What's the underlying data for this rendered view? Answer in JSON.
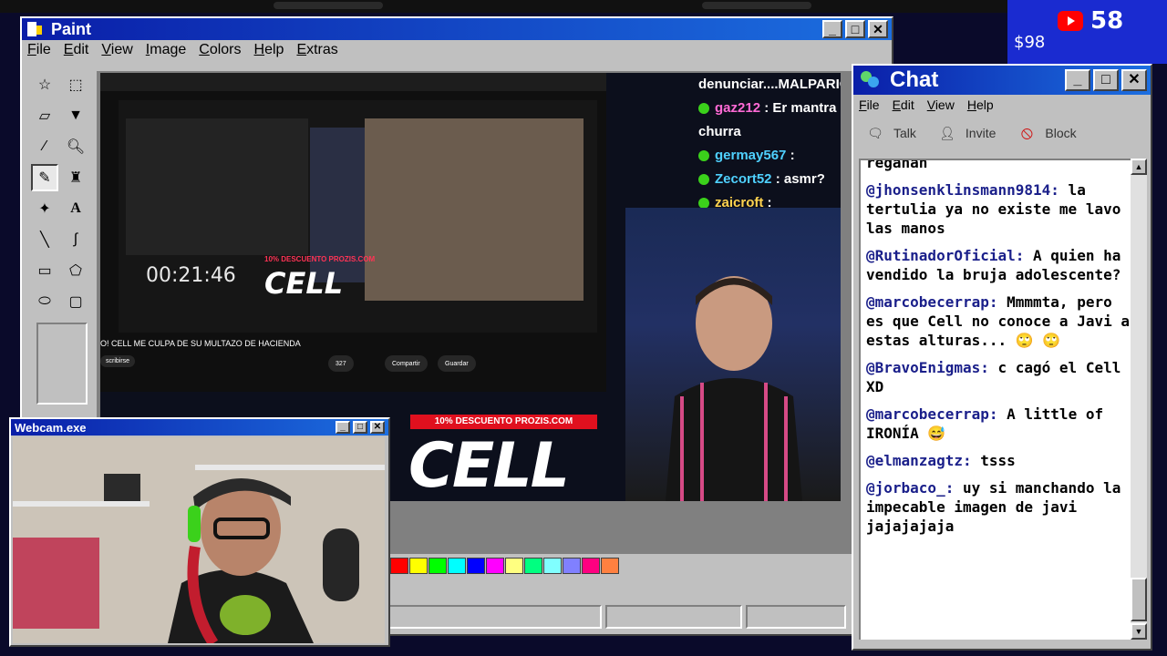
{
  "stream_overlay": {
    "viewer_count": "58",
    "left_num": "$98"
  },
  "paint": {
    "title": "Paint",
    "menu": [
      "File",
      "Edit",
      "View",
      "Image",
      "Colors",
      "Help",
      "Extras"
    ],
    "palette": [
      "#ff0000",
      "#ffff00",
      "#00ff00",
      "#00ffff",
      "#0000ff",
      "#ff00ff",
      "#ffff80",
      "#00ff80",
      "#80ffff",
      "#8080ff",
      "#ff0080",
      "#ff8040"
    ]
  },
  "capture": {
    "timer": "00:21:46",
    "cell_logo": "CELL",
    "promo": "10% DESCUENTO PROZIS.COM",
    "yt_caption": "O! CELL ME CULPA DE SU MULTAZO DE HACIENDA",
    "yt_buttons": [
      "327",
      "Compartir",
      "Guardar"
    ],
    "subscribe": "scribirse",
    "stream_chat": [
      {
        "user": "",
        "text": "denunciar....MALPARIO",
        "dot": false
      },
      {
        "user": "gaz212",
        "text": ": Er mantra",
        "dot": true
      },
      {
        "user": "",
        "text": "churra",
        "dot": false
      },
      {
        "user": "germay567",
        "text": ":",
        "dot": true
      },
      {
        "user": "Zecort52",
        "text": ": asmr?",
        "dot": true
      },
      {
        "user": "zaicroft",
        "text": ":",
        "dot": true
      }
    ]
  },
  "webcam": {
    "title": "Webcam.exe"
  },
  "chat": {
    "title": "Chat",
    "menu": [
      "File",
      "Edit",
      "View",
      "Help"
    ],
    "tools": [
      "Talk",
      "Invite",
      "Block"
    ],
    "partial": "reganan",
    "messages": [
      {
        "user": "@jhonsenklinsmann9814:",
        "text": " la tertulia ya no existe me lavo las manos"
      },
      {
        "user": "@RutinadorOficial:",
        "text": " A quien ha vendido la bruja adolescente?"
      },
      {
        "user": "@marcobecerrap:",
        "text": " Mmmmta, pero es que Cell no conoce a Javi a estas alturas... 🙄 🙄"
      },
      {
        "user": "@BravoEnigmas:",
        "text": " c cagó el Cell XD"
      },
      {
        "user": "@marcobecerrap:",
        "text": " A little of IRONÍA 😅"
      },
      {
        "user": "@elmanzagtz:",
        "text": " tsss"
      },
      {
        "user": "@jorbaco_:",
        "text": " uy si manchando la impecable imagen de javi jajajajaja"
      }
    ]
  }
}
